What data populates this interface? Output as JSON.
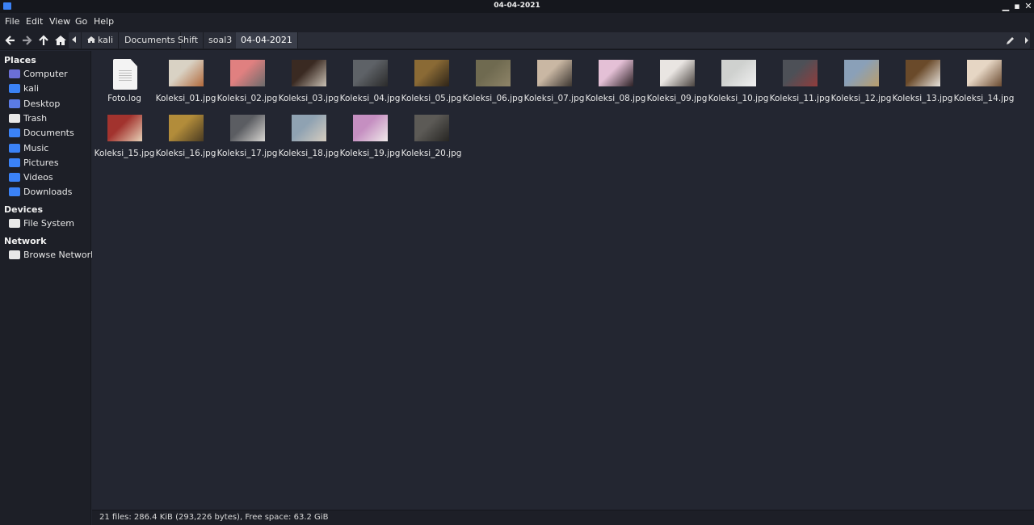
{
  "window": {
    "title": "04-04-2021"
  },
  "menu": [
    "File",
    "Edit",
    "View",
    "Go",
    "Help"
  ],
  "breadcrumb": [
    "kali",
    "Documents",
    "Shift",
    "soal3",
    "04-04-2021"
  ],
  "sidebar": {
    "places_header": "Places",
    "places": [
      {
        "label": "Computer",
        "icon": "computer-icon",
        "color": "#6b6fd6"
      },
      {
        "label": "kali",
        "icon": "home-folder-icon",
        "color": "#3b82f6"
      },
      {
        "label": "Desktop",
        "icon": "desktop-folder-icon",
        "color": "#5b7be6"
      },
      {
        "label": "Trash",
        "icon": "trash-icon",
        "color": "#e8e8e8"
      },
      {
        "label": "Documents",
        "icon": "documents-folder-icon",
        "color": "#3b82f6"
      },
      {
        "label": "Music",
        "icon": "music-folder-icon",
        "color": "#3b82f6"
      },
      {
        "label": "Pictures",
        "icon": "pictures-folder-icon",
        "color": "#3b82f6"
      },
      {
        "label": "Videos",
        "icon": "videos-folder-icon",
        "color": "#3b82f6"
      },
      {
        "label": "Downloads",
        "icon": "downloads-folder-icon",
        "color": "#3b82f6"
      }
    ],
    "devices_header": "Devices",
    "devices": [
      {
        "label": "File System",
        "icon": "drive-icon",
        "color": "#e8e8e8"
      }
    ],
    "network_header": "Network",
    "network": [
      {
        "label": "Browse Network",
        "icon": "network-icon",
        "color": "#e8e8e8"
      }
    ]
  },
  "files": [
    {
      "name": "Foto.log",
      "type": "text"
    },
    {
      "name": "Koleksi_01.jpg",
      "type": "image",
      "colors": [
        "#d9d2c4",
        "#b26a3c"
      ]
    },
    {
      "name": "Koleksi_02.jpg",
      "type": "image",
      "colors": [
        "#e08080",
        "#6b6b6b"
      ]
    },
    {
      "name": "Koleksi_03.jpg",
      "type": "image",
      "colors": [
        "#3a2a22",
        "#c9c0b4"
      ]
    },
    {
      "name": "Koleksi_04.jpg",
      "type": "image",
      "colors": [
        "#5e6267",
        "#2a2a2a"
      ]
    },
    {
      "name": "Koleksi_05.jpg",
      "type": "image",
      "colors": [
        "#8a6a35",
        "#2e2418"
      ]
    },
    {
      "name": "Koleksi_06.jpg",
      "type": "image",
      "colors": [
        "#6f6a50",
        "#8e8468"
      ]
    },
    {
      "name": "Koleksi_07.jpg",
      "type": "image",
      "colors": [
        "#c9b7a3",
        "#3b3530"
      ]
    },
    {
      "name": "Koleksi_08.jpg",
      "type": "image",
      "colors": [
        "#e4c0d6",
        "#2c2024"
      ]
    },
    {
      "name": "Koleksi_09.jpg",
      "type": "image",
      "colors": [
        "#e9e5e2",
        "#4a4440"
      ]
    },
    {
      "name": "Koleksi_10.jpg",
      "type": "image",
      "colors": [
        "#cfd1cf",
        "#f0f0f0"
      ]
    },
    {
      "name": "Koleksi_11.jpg",
      "type": "image",
      "colors": [
        "#4d5057",
        "#913c3c"
      ]
    },
    {
      "name": "Koleksi_12.jpg",
      "type": "image",
      "colors": [
        "#8aa0b8",
        "#b99e6c"
      ]
    },
    {
      "name": "Koleksi_13.jpg",
      "type": "image",
      "colors": [
        "#6a4a2a",
        "#e8e4de"
      ]
    },
    {
      "name": "Koleksi_14.jpg",
      "type": "image",
      "colors": [
        "#e6d6c4",
        "#6a4a30"
      ]
    },
    {
      "name": "Koleksi_15.jpg",
      "type": "image",
      "colors": [
        "#a2332e",
        "#e8d2b8"
      ]
    },
    {
      "name": "Koleksi_16.jpg",
      "type": "image",
      "colors": [
        "#b28c3a",
        "#4a3b22"
      ]
    },
    {
      "name": "Koleksi_17.jpg",
      "type": "image",
      "colors": [
        "#5b5d62",
        "#d8d6d2"
      ]
    },
    {
      "name": "Koleksi_18.jpg",
      "type": "image",
      "colors": [
        "#8fa2b2",
        "#d6cdc0"
      ]
    },
    {
      "name": "Koleksi_19.jpg",
      "type": "image",
      "colors": [
        "#c58fc1",
        "#f0eaea"
      ]
    },
    {
      "name": "Koleksi_20.jpg",
      "type": "image",
      "colors": [
        "#5c5a56",
        "#262522"
      ]
    }
  ],
  "status": {
    "text": "21 files: 286.4 KiB (293,226 bytes), Free space: 63.2 GiB"
  }
}
